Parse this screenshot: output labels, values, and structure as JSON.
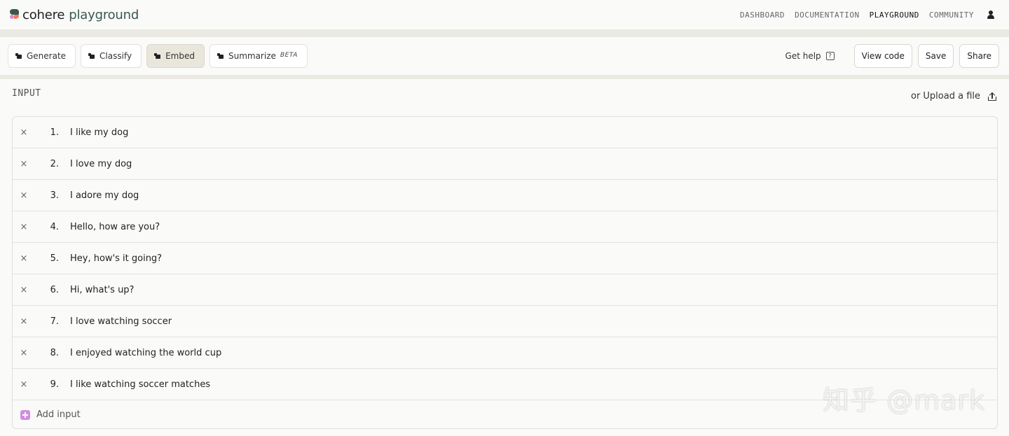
{
  "brand": {
    "name": "cohere",
    "product": "playground"
  },
  "nav": {
    "items": [
      {
        "label": "DASHBOARD",
        "active": false
      },
      {
        "label": "DOCUMENTATION",
        "active": false
      },
      {
        "label": "PLAYGROUND",
        "active": true
      },
      {
        "label": "COMMUNITY",
        "active": false
      }
    ]
  },
  "toolbar": {
    "tabs": [
      {
        "label": "Generate",
        "active": false
      },
      {
        "label": "Classify",
        "active": false
      },
      {
        "label": "Embed",
        "active": true
      },
      {
        "label": "Summarize",
        "badge": "BETA",
        "active": false
      }
    ],
    "help_label": "Get help",
    "help_glyph": "?",
    "view_code_label": "View code",
    "save_label": "Save",
    "share_label": "Share"
  },
  "input": {
    "section_label": "INPUT",
    "upload_label": "or Upload a file",
    "items": [
      {
        "number": "1.",
        "text": "I like my dog"
      },
      {
        "number": "2.",
        "text": "I love my dog"
      },
      {
        "number": "3.",
        "text": "I adore my dog"
      },
      {
        "number": "4.",
        "text": "Hello, how are you?"
      },
      {
        "number": "5.",
        "text": "Hey, how's it going?"
      },
      {
        "number": "6.",
        "text": "Hi, what's up?"
      },
      {
        "number": "7.",
        "text": "I love watching soccer"
      },
      {
        "number": "8.",
        "text": "I enjoyed watching the world cup"
      },
      {
        "number": "9.",
        "text": "I like watching soccer matches"
      }
    ],
    "delete_glyph": "×",
    "add_label": "Add input"
  },
  "watermark": "知乎 @mark",
  "colors": {
    "accent_pink": "#d18ee2",
    "brand_green": "#39594d",
    "brand_coral": "#ff7759",
    "background": "#ebeae2",
    "panel": "#fafaf9"
  }
}
